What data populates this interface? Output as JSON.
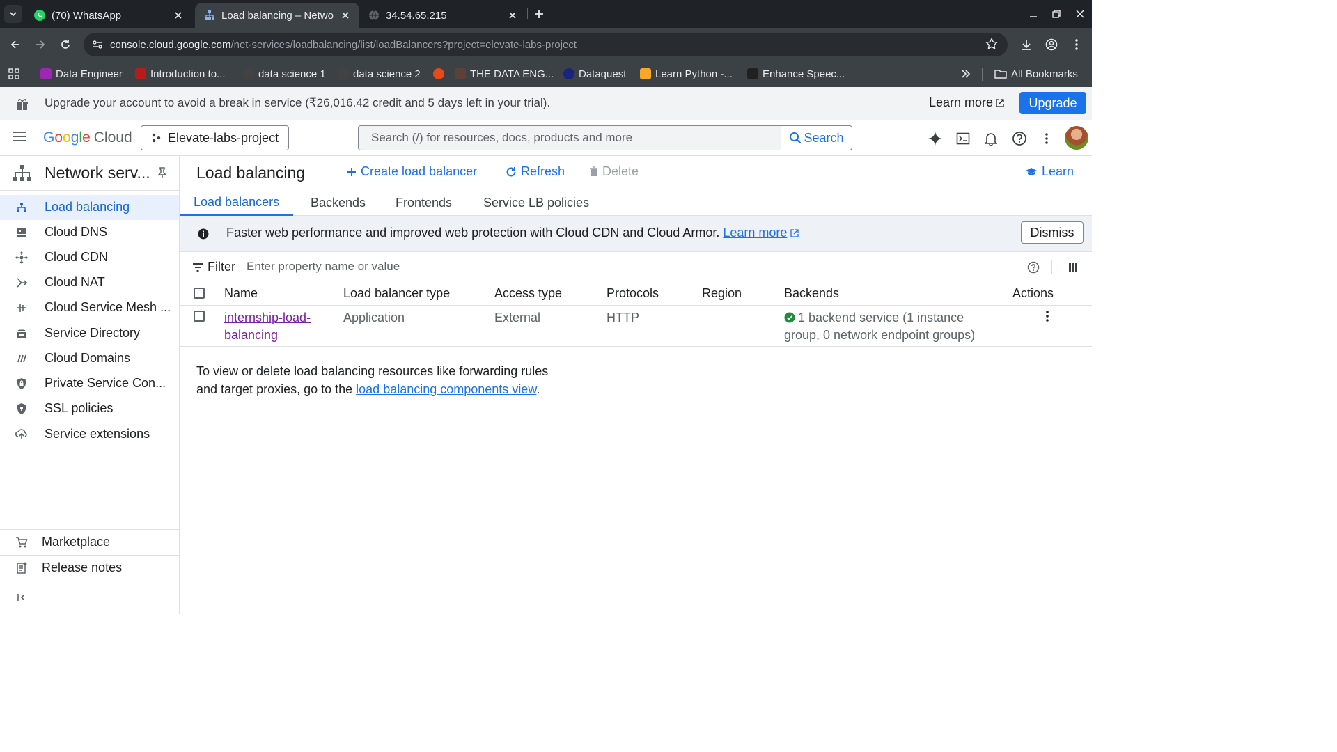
{
  "browser": {
    "tabs": [
      {
        "title": "(70) WhatsApp",
        "icon": "whatsapp-icon"
      },
      {
        "title": "Load balancing – Netwo",
        "icon": "network-services-icon"
      },
      {
        "title": "34.54.65.215",
        "icon": "globe-icon"
      }
    ],
    "url_host": "console.cloud.google.com",
    "url_path": "/net-services/loadbalancing/list/loadBalancers?project=elevate-labs-project",
    "bookmarks": [
      {
        "label": "Data Engineer",
        "color": "#9c27b0"
      },
      {
        "label": "Introduction to...",
        "color": "#b71c1c"
      },
      {
        "label": "data science 1",
        "color": "#424242"
      },
      {
        "label": "data science 2",
        "color": "#424242"
      },
      {
        "label": "",
        "color": "#e64a19"
      },
      {
        "label": "THE DATA ENG...",
        "color": "#5d4037"
      },
      {
        "label": "Dataquest",
        "color": "#1a237e"
      },
      {
        "label": "Learn Python -...",
        "color": "#f9a825"
      },
      {
        "label": "Enhance Speec...",
        "color": "#212121"
      }
    ],
    "all_bookmarks": "All Bookmarks"
  },
  "trial": {
    "message": "Upgrade your account to avoid a break in service (₹26,016.42 credit and 5 days left in your trial).",
    "learn_more": "Learn more",
    "upgrade": "Upgrade"
  },
  "header": {
    "logo_google": "Google",
    "logo_cloud": "Cloud",
    "project": "Elevate-labs-project",
    "search_placeholder": "Search (/) for resources, docs, products and more",
    "search_button": "Search"
  },
  "sidebar": {
    "title": "Network serv...",
    "items": [
      {
        "label": "Load balancing",
        "icon": "load-balancing-icon"
      },
      {
        "label": "Cloud DNS",
        "icon": "dns-icon"
      },
      {
        "label": "Cloud CDN",
        "icon": "cdn-icon"
      },
      {
        "label": "Cloud NAT",
        "icon": "nat-icon"
      },
      {
        "label": "Cloud Service Mesh ...",
        "icon": "service-mesh-icon"
      },
      {
        "label": "Service Directory",
        "icon": "service-directory-icon"
      },
      {
        "label": "Cloud Domains",
        "icon": "domains-icon"
      },
      {
        "label": "Private Service Con...",
        "icon": "private-connect-icon"
      },
      {
        "label": "SSL policies",
        "icon": "ssl-shield-icon"
      },
      {
        "label": "Service extensions",
        "icon": "extensions-icon"
      }
    ],
    "marketplace": "Marketplace",
    "release_notes": "Release notes"
  },
  "page": {
    "title": "Load balancing",
    "create": "Create load balancer",
    "refresh": "Refresh",
    "delete": "Delete",
    "learn": "Learn",
    "tabs": [
      "Load balancers",
      "Backends",
      "Frontends",
      "Service LB policies"
    ],
    "banner_text": "Faster web performance and improved web protection with Cloud CDN and Cloud Armor.",
    "banner_link": "Learn more",
    "dismiss": "Dismiss",
    "filter_label": "Filter",
    "filter_placeholder": "Enter property name or value",
    "columns": [
      "Name",
      "Load balancer type",
      "Access type",
      "Protocols",
      "Region",
      "Backends",
      "Actions"
    ],
    "rows": [
      {
        "name_line1": "internship-load-",
        "name_line2": "balancing",
        "type": "Application",
        "access": "External",
        "protocols": "HTTP",
        "region": "",
        "backends_line1": "1 backend service (1 instance",
        "backends_line2": "group, 0 network endpoint groups)"
      }
    ],
    "note_text_1": "To view or delete load balancing resources like forwarding rules and target proxies, go to the ",
    "note_link": "load balancing components view",
    "note_text_2": "."
  },
  "colors": {
    "accent": "#1a73e8",
    "ok": "#1e8e3e"
  }
}
